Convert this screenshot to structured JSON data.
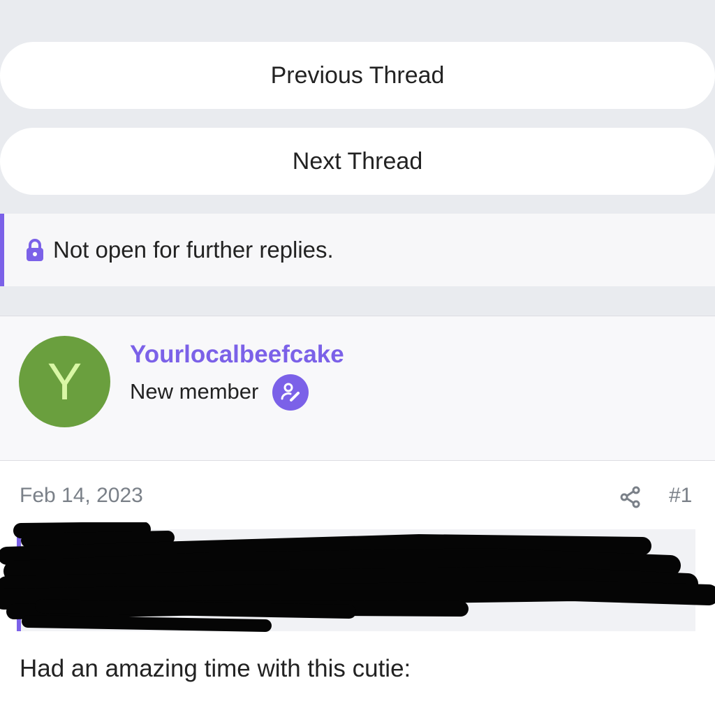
{
  "nav": {
    "previous_label": "Previous Thread",
    "next_label": "Next Thread"
  },
  "notice": {
    "text": "Not open for further replies.",
    "icon": "lock-icon"
  },
  "post": {
    "author": {
      "avatar_letter": "Y",
      "name": "Yourlocalbeefcake",
      "title": "New member",
      "badge_icon": "user-edit-icon"
    },
    "date": "Feb 14, 2023",
    "number": "#1",
    "share_icon": "share-icon",
    "quote_redacted": true,
    "body_text": "Had an amazing time with this cutie:"
  },
  "colors": {
    "accent": "#7b61e8",
    "avatar_bg": "#6a9f3e",
    "avatar_letter": "#d9f7a5",
    "page_bg": "#e9ebef"
  }
}
